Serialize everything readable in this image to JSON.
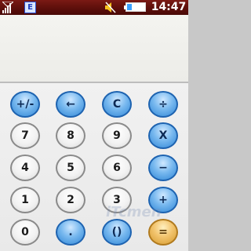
{
  "status_bar": {
    "network_letter": "E",
    "time": "14:47",
    "icons": [
      "signal-icon",
      "network-icon",
      "mute-icon",
      "battery-icon"
    ]
  },
  "display": {
    "value": ""
  },
  "keypad": {
    "rows": [
      [
        "+/-",
        "←",
        "C",
        "÷"
      ],
      [
        "7",
        "8",
        "9",
        "X"
      ],
      [
        "4",
        "5",
        "6",
        "−"
      ],
      [
        "1",
        "2",
        "3",
        "+"
      ],
      [
        "0",
        ".",
        "()",
        "="
      ]
    ]
  },
  "watermark": "iTcmen",
  "colors": {
    "operator_blue": "#4d9ee6",
    "digit_gray": "#f0f0f0",
    "equals_gold": "#e0ad4d",
    "statusbar_red": "#6b1410"
  }
}
